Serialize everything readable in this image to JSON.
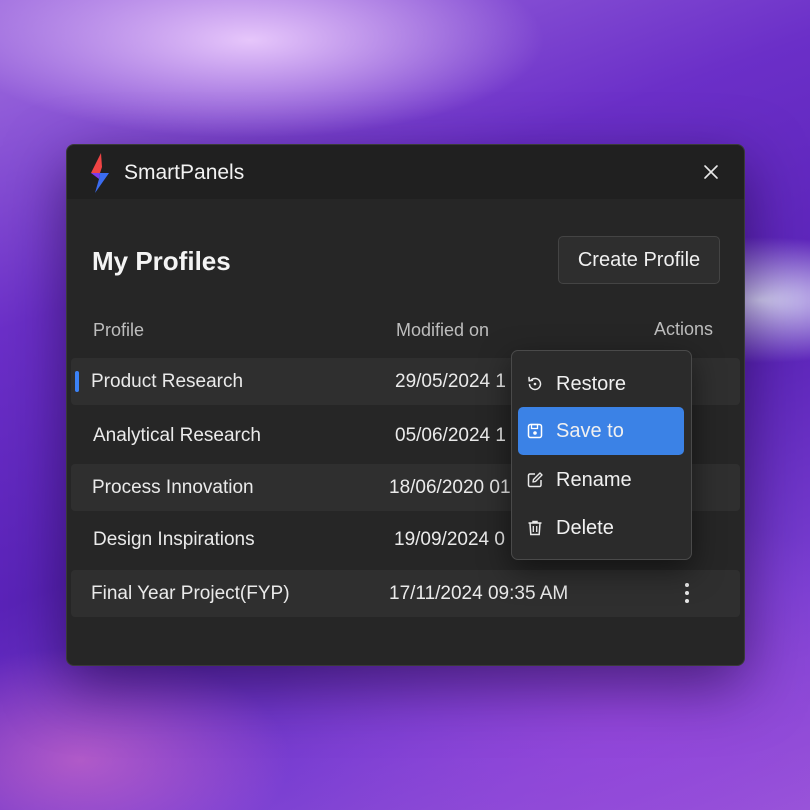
{
  "app": {
    "title": "SmartPanels",
    "close_icon": "close-icon",
    "logo_icon": "lightning-logo"
  },
  "page": {
    "heading": "My Profiles",
    "create_button": "Create Profile"
  },
  "table": {
    "headers": {
      "profile": "Profile",
      "modified": "Modified on",
      "actions": "Actions"
    },
    "rows": [
      {
        "name": "Product Research",
        "modified": "29/05/2024 1",
        "selected": true
      },
      {
        "name": "Analytical Research",
        "modified": "05/06/2024 1",
        "selected": false
      },
      {
        "name": "Process Innovation",
        "modified": "18/06/2020 01",
        "selected": false
      },
      {
        "name": "Design Inspirations",
        "modified": "19/09/2024 0",
        "selected": false
      },
      {
        "name": "Final Year Project(FYP)",
        "modified": "17/11/2024 09:35 AM",
        "selected": false
      }
    ]
  },
  "context_menu": {
    "items": [
      {
        "label": "Restore",
        "icon": "restore-icon",
        "active": false
      },
      {
        "label": "Save to",
        "icon": "save-icon",
        "active": true
      },
      {
        "label": "Rename",
        "icon": "rename-icon",
        "active": false
      },
      {
        "label": "Delete",
        "icon": "delete-icon",
        "active": false
      }
    ]
  },
  "colors": {
    "accent": "#3b82e6",
    "window_bg": "#262626",
    "titlebar_bg": "#202020"
  }
}
